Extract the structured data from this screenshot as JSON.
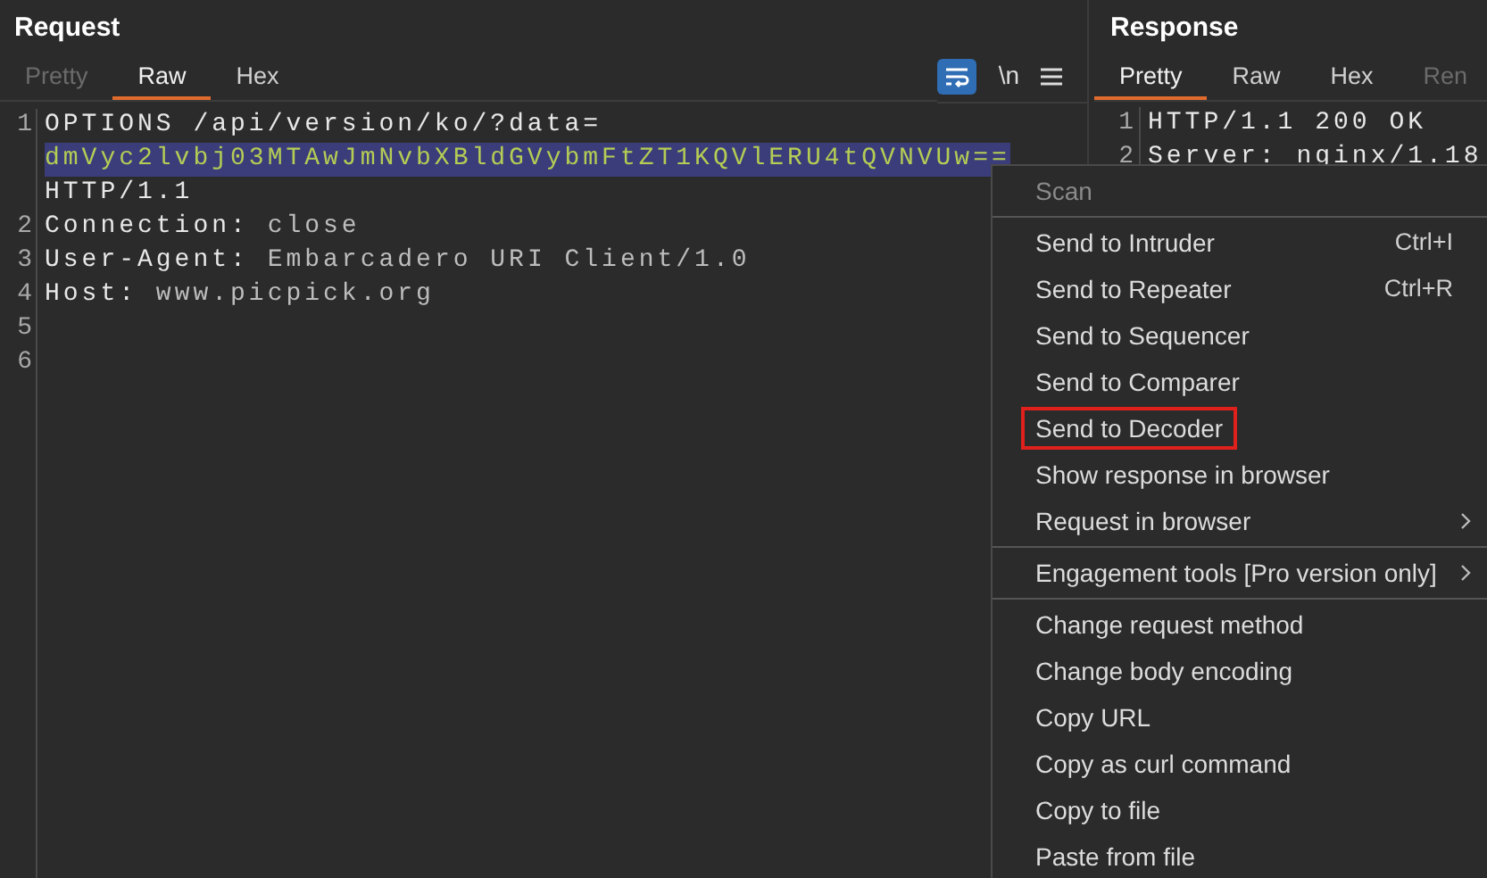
{
  "request": {
    "title": "Request",
    "tabs": [
      {
        "label": "Pretty",
        "selected": false,
        "disabled": true
      },
      {
        "label": "Raw",
        "selected": true,
        "disabled": false
      },
      {
        "label": "Hex",
        "selected": false,
        "disabled": false
      }
    ],
    "toolbar": {
      "wrap_on": true,
      "newline_label": "\\n"
    },
    "lines": [
      {
        "number": "1",
        "parts": [
          {
            "text": "OPTIONS /api/version/ko/?data=",
            "kind": "name"
          },
          {
            "text": "dmVyc2lvbj03MTAwJmNvbXBldGVybmFtZT1KQVlERU4tQVNVUw==",
            "kind": "selected"
          },
          {
            "text": "HTTP/1.1",
            "kind": "name"
          }
        ]
      },
      {
        "number": "2",
        "parts": [
          {
            "text": "Connection: ",
            "kind": "name"
          },
          {
            "text": "close",
            "kind": "value"
          }
        ]
      },
      {
        "number": "3",
        "parts": [
          {
            "text": "User-Agent: ",
            "kind": "name"
          },
          {
            "text": "Embarcadero URI Client/1.0",
            "kind": "value"
          }
        ]
      },
      {
        "number": "4",
        "parts": [
          {
            "text": "Host: ",
            "kind": "name"
          },
          {
            "text": "www.picpick.org",
            "kind": "value"
          }
        ]
      },
      {
        "number": "5"
      },
      {
        "number": "6"
      }
    ]
  },
  "response": {
    "title": "Response",
    "tabs": [
      {
        "label": "Pretty",
        "selected": true,
        "disabled": false
      },
      {
        "label": "Raw",
        "selected": false,
        "disabled": false
      },
      {
        "label": "Hex",
        "selected": false,
        "disabled": false
      },
      {
        "label": "Ren",
        "selected": false,
        "disabled": true
      }
    ],
    "lines": [
      {
        "number": "1",
        "text": "HTTP/1.1 200 OK"
      },
      {
        "number": "2",
        "text": "Server: nginx/1.18"
      }
    ]
  },
  "context_menu": {
    "groups": [
      [
        {
          "label": "Scan",
          "disabled": true,
          "outlined": false
        }
      ],
      [
        {
          "label": "Send to Intruder",
          "shortcut": "Ctrl+I",
          "disabled": false,
          "outlined": false
        },
        {
          "label": "Send to Repeater",
          "shortcut": "Ctrl+R",
          "disabled": false,
          "outlined": false
        },
        {
          "label": "Send to Sequencer",
          "disabled": false,
          "outlined": false
        },
        {
          "label": "Send to Comparer",
          "disabled": false,
          "outlined": false
        },
        {
          "label": "Send to Decoder",
          "disabled": false,
          "outlined": true
        },
        {
          "label": "Show response in browser",
          "disabled": false,
          "outlined": false
        },
        {
          "label": "Request in browser",
          "submenu": true,
          "disabled": false,
          "outlined": false
        }
      ],
      [
        {
          "label": "Engagement tools [Pro version only]",
          "submenu": true,
          "disabled": false,
          "outlined": false
        }
      ],
      [
        {
          "label": "Change request method",
          "disabled": false,
          "outlined": false
        },
        {
          "label": "Change body encoding",
          "disabled": false,
          "outlined": false
        },
        {
          "label": "Copy URL",
          "disabled": false,
          "outlined": false
        },
        {
          "label": "Copy as curl command",
          "disabled": false,
          "outlined": false
        },
        {
          "label": "Copy to file",
          "disabled": false,
          "outlined": false
        },
        {
          "label": "Paste from file",
          "disabled": false,
          "outlined": false
        }
      ]
    ]
  }
}
